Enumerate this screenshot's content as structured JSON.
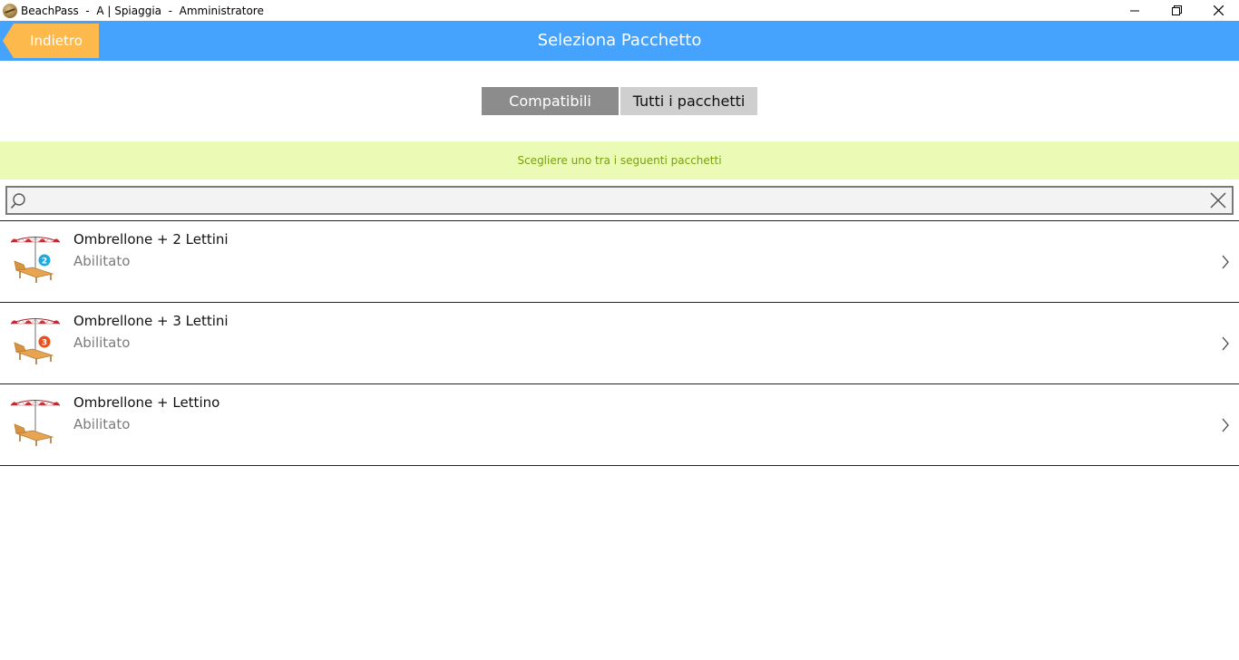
{
  "window": {
    "title": "BeachPass  -  A | Spiaggia  -  Amministratore",
    "controls": [
      "minimize-icon",
      "restore-icon",
      "close-icon"
    ]
  },
  "header": {
    "back_label": "Indietro",
    "title": "Seleziona Pacchetto"
  },
  "tabs": {
    "compatible": "Compatibili",
    "all": "Tutti i pacchetti"
  },
  "banner": {
    "text": "Scegliere uno tra i seguenti pacchetti"
  },
  "search": {
    "value": "",
    "placeholder": ""
  },
  "packages": [
    {
      "name": "Ombrellone + 2 Lettini",
      "status": "Abilitato",
      "badge": "2",
      "badge_color": "#1fa9e0"
    },
    {
      "name": "Ombrellone + 3 Lettini",
      "status": "Abilitato",
      "badge": "3",
      "badge_color": "#e8501c"
    },
    {
      "name": "Ombrellone + Lettino",
      "status": "Abilitato",
      "badge": "",
      "badge_color": ""
    }
  ],
  "colors": {
    "header": "#45a3fd",
    "back_button": "#fdb94b",
    "tab_active": "#8c8c8c",
    "tab_inactive": "#cfcfcf",
    "banner_bg": "#ebfbb6",
    "banner_text": "#7aa00b"
  }
}
